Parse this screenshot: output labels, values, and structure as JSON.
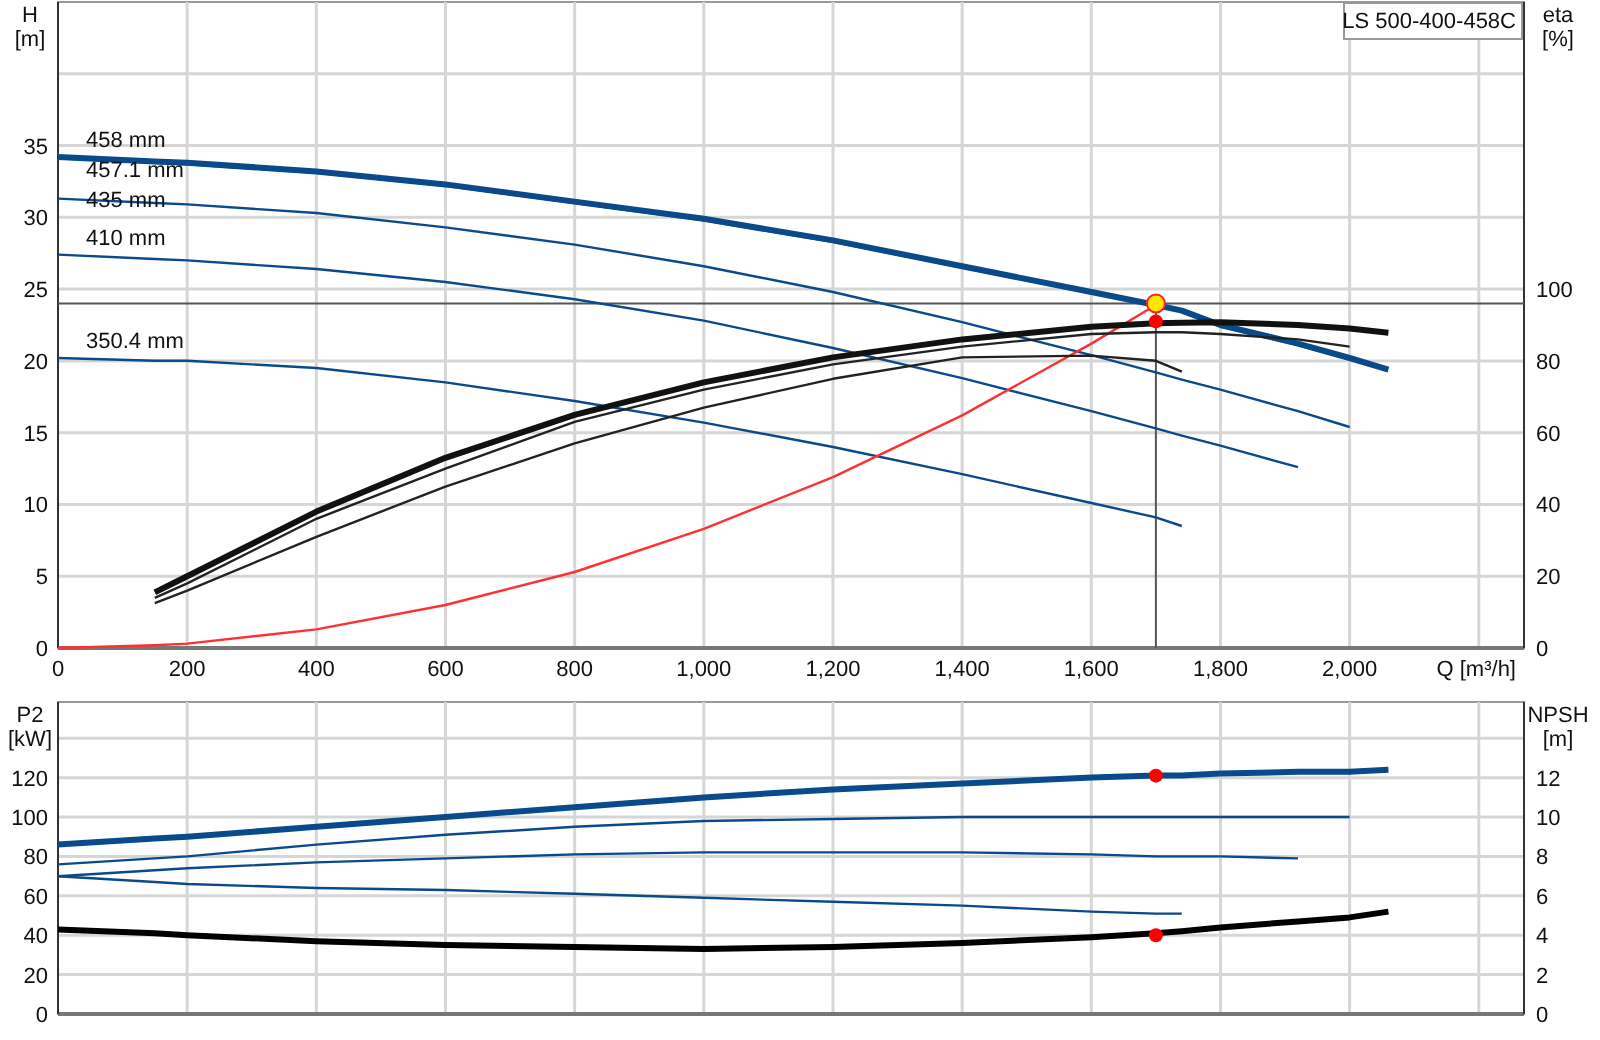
{
  "head_chart": {
    "title": "LS 500-400-458C",
    "chart_data": {
      "type": "line",
      "xlabel": "Q [m³/h]",
      "ylabel": "H\n[m]",
      "x": [
        0,
        150,
        200,
        400,
        600,
        800,
        1000,
        1200,
        1400,
        1600,
        1700,
        1740,
        1800,
        1920,
        2000,
        2060
      ],
      "xlim": [
        0,
        2270
      ],
      "ylim": [
        0,
        45
      ],
      "xticks": [
        0,
        200,
        400,
        600,
        800,
        {
          "value": 1000,
          "label": "1,000"
        },
        {
          "value": 1200,
          "label": "1,200"
        },
        {
          "value": 1400,
          "label": "1,400"
        },
        {
          "value": 1600,
          "label": "1,600"
        },
        {
          "value": 1800,
          "label": "1,800"
        },
        {
          "value": 2000,
          "label": "2,000"
        }
      ],
      "yticks": [
        0,
        5,
        10,
        15,
        20,
        25,
        30,
        35
      ],
      "ref_lines": [
        {
          "axis": "y",
          "value": 24
        },
        {
          "axis": "x",
          "value": 1700
        }
      ],
      "series": [
        {
          "name": "458 mm",
          "color": "#0b4a8a",
          "values": [
            34.2,
            33.9,
            33.8,
            33.2,
            32.3,
            31.1,
            29.9,
            28.4,
            26.6,
            24.8,
            23.9,
            23.5,
            22.5,
            21.2,
            20.2,
            19.4
          ]
        },
        {
          "name": "457.1 mm",
          "color": "#0b4a8a",
          "values": [
            34.1,
            33.8,
            33.7,
            33.1,
            32.2,
            31.0,
            29.8,
            28.3,
            26.5,
            24.7,
            null,
            23.4,
            22.4,
            21.1,
            20.1,
            null
          ]
        },
        {
          "name": "435 mm",
          "color": "#0b4a8a",
          "values": [
            31.3,
            31.0,
            30.9,
            30.3,
            29.3,
            28.1,
            26.6,
            24.8,
            22.7,
            20.4,
            19.2,
            18.7,
            18.0,
            16.5,
            15.4,
            null
          ]
        },
        {
          "name": "410 mm",
          "color": "#0b4a8a",
          "values": [
            27.4,
            27.1,
            27.0,
            26.4,
            25.5,
            24.3,
            22.8,
            20.9,
            18.8,
            16.5,
            15.3,
            14.8,
            14.1,
            12.6,
            null,
            null
          ]
        },
        {
          "name": "350.4 mm",
          "color": "#0b4a8a",
          "values": [
            20.2,
            20.0,
            20.0,
            19.5,
            18.5,
            17.2,
            15.7,
            14.0,
            12.1,
            10.1,
            9.1,
            8.5,
            null,
            null,
            null,
            null
          ]
        },
        {
          "color": "#ff3030",
          "values": [
            0,
            0.2,
            0.3,
            1.3,
            3.0,
            5.3,
            8.3,
            11.9,
            16.2,
            21.2,
            23.9,
            null,
            null,
            null,
            null,
            null
          ]
        },
        {
          "color": "#ffe600",
          "marker": true,
          "values": [
            null,
            null,
            null,
            null,
            null,
            null,
            null,
            null,
            null,
            null,
            24,
            null,
            null,
            null,
            null,
            null
          ]
        }
      ]
    }
  },
  "efficiency_chart": {
    "chart_data": {
      "type": "line",
      "ylabel": "eta\n[%]",
      "x": [
        150,
        200,
        400,
        600,
        800,
        1000,
        1200,
        1400,
        1600,
        1700,
        1740,
        1800,
        1920,
        2000,
        2060
      ],
      "xlim": [
        0,
        2270
      ],
      "ylim": [
        0,
        180
      ],
      "yticks": [
        0,
        20,
        40,
        60,
        80,
        100
      ],
      "series": [
        {
          "color": "#111111",
          "values": [
            15.5,
            20,
            38,
            53,
            65,
            74,
            81,
            86,
            89.5,
            90.5,
            90.6,
            90.8,
            90,
            89,
            87.8
          ]
        },
        {
          "color": "#222222",
          "values": [
            14,
            18,
            36,
            50,
            63,
            72,
            79,
            84,
            87.5,
            88,
            88,
            87.5,
            86,
            84,
            null
          ]
        },
        {
          "color": "#222222",
          "values": [
            12.5,
            16,
            31,
            45,
            57,
            67,
            75,
            81,
            81.5,
            80,
            77,
            null,
            null,
            null,
            null
          ]
        },
        {
          "color": "#ff0000",
          "marker": true,
          "values": [
            null,
            null,
            null,
            null,
            null,
            null,
            null,
            null,
            null,
            91,
            null,
            null,
            null,
            null,
            null
          ]
        }
      ]
    }
  },
  "power_chart": {
    "chart_data": {
      "type": "line",
      "ylabel": "P2\n[kW]",
      "x": [
        0,
        150,
        200,
        400,
        600,
        800,
        1000,
        1200,
        1400,
        1600,
        1700,
        1740,
        1800,
        1920,
        2000,
        2060
      ],
      "xlim": [
        0,
        2270
      ],
      "ylim": [
        0,
        158.4
      ],
      "yticks": [
        0,
        20,
        40,
        60,
        80,
        100,
        120
      ],
      "series": [
        {
          "color": "#0b4a8a",
          "values": [
            86,
            89,
            90,
            95,
            100,
            105,
            110,
            114,
            117,
            120,
            121,
            121,
            122,
            123,
            123,
            124
          ]
        },
        {
          "color": "#0b4a8a",
          "values": [
            76,
            79,
            80,
            86,
            91,
            95,
            98,
            99,
            100,
            100,
            100,
            100,
            100,
            100,
            100,
            null
          ]
        },
        {
          "color": "#0b4a8a",
          "values": [
            70,
            73,
            74,
            77,
            79,
            81,
            82,
            82,
            82,
            81,
            80,
            80,
            80,
            79,
            null,
            null
          ]
        },
        {
          "color": "#0b4a8a",
          "values": [
            70,
            67,
            66,
            64,
            63,
            61,
            59,
            57,
            55,
            52,
            51,
            51,
            null,
            null,
            null,
            null
          ]
        },
        {
          "color": "#ff0000",
          "marker": true,
          "values": [
            null,
            null,
            null,
            null,
            null,
            null,
            null,
            null,
            null,
            null,
            121,
            null,
            null,
            null,
            null,
            null
          ]
        }
      ]
    }
  },
  "npsh_chart": {
    "chart_data": {
      "type": "line",
      "ylabel": "NPSH\n[m]",
      "x": [
        0,
        150,
        200,
        400,
        600,
        800,
        1000,
        1200,
        1400,
        1600,
        1700,
        1740,
        1800,
        1920,
        2000,
        2060
      ],
      "xlim": [
        0,
        2270
      ],
      "ylim": [
        0,
        15.84
      ],
      "yticks": [
        0,
        2,
        4,
        6,
        8,
        10,
        12
      ],
      "series": [
        {
          "color": "#000000",
          "values": [
            4.3,
            4.1,
            4.0,
            3.7,
            3.5,
            3.4,
            3.3,
            3.4,
            3.6,
            3.9,
            4.1,
            4.2,
            4.4,
            4.7,
            4.9,
            5.2
          ]
        },
        {
          "color": "#ff0000",
          "marker": true,
          "values": [
            null,
            null,
            null,
            null,
            null,
            null,
            null,
            null,
            null,
            null,
            4.0,
            null,
            null,
            null,
            null,
            null
          ]
        }
      ]
    }
  }
}
